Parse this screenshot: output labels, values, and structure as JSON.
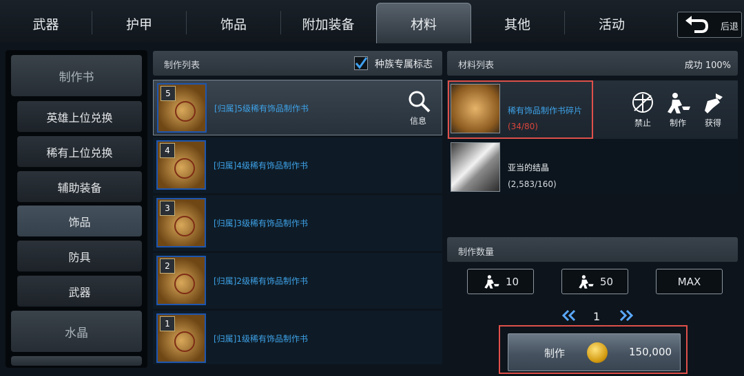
{
  "tabs": [
    "武器",
    "护甲",
    "饰品",
    "附加装备",
    "材料",
    "其他",
    "活动"
  ],
  "active_tab": "材料",
  "back_label": "后退",
  "categories": [
    "制作书",
    "水晶"
  ],
  "subcategories": [
    "英雄上位兑换",
    "稀有上位兑换",
    "辅助装备",
    "饰品",
    "防具",
    "武器"
  ],
  "selected_subcategory": "饰品",
  "craft_list": {
    "title": "制作列表",
    "race_flag_label": "种族专属标志",
    "race_flag_checked": true,
    "items": [
      {
        "level": "5",
        "name": "[归属]5级稀有饰品制作书"
      },
      {
        "level": "4",
        "name": "[归属]4级稀有饰品制作书"
      },
      {
        "level": "3",
        "name": "[归属]3级稀有饰品制作书"
      },
      {
        "level": "2",
        "name": "[归属]2级稀有饰品制作书"
      },
      {
        "level": "1",
        "name": "[归属]1级稀有饰品制作书"
      }
    ],
    "info_label": "信息"
  },
  "materials": {
    "title": "材料列表",
    "success": "成功 100%",
    "items": [
      {
        "name": "稀有饰品制作书碎片",
        "count": "(34/80)"
      },
      {
        "name": "亚当的结晶",
        "count": "(2,583/160)"
      }
    ],
    "actions": [
      "禁止",
      "制作",
      "获得"
    ]
  },
  "quantity": {
    "title": "制作数量",
    "buttons": [
      "10",
      "50",
      "MAX"
    ],
    "page": "1"
  },
  "craft": {
    "label": "制作",
    "cost": "150,000"
  },
  "colors": {
    "item_name": "#3ea2e8",
    "insufficient": "#d8453c",
    "highlight": "#e0504a"
  }
}
